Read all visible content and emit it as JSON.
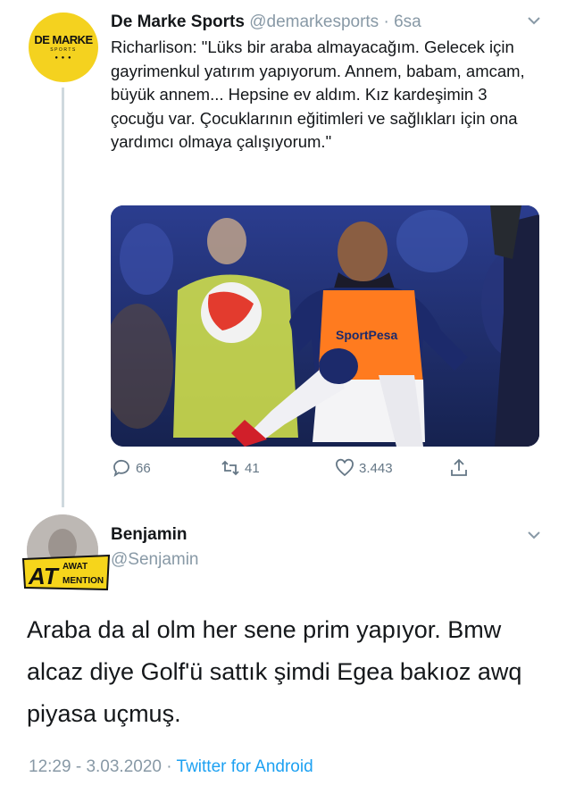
{
  "parent_tweet": {
    "author_name": "De Marke Sports",
    "author_handle": "@demarkesports",
    "separator": " · ",
    "time_ago": "6sa",
    "avatar_logo": "DE MARKE",
    "avatar_sub": "SPORTS",
    "text": "Richarlison: \"Lüks bir araba almayacağım. Gelecek için gayrimenkul yatırım yapıyorum. Annem, babam, amcam, büyük annem... Hepsine ev aldım. Kız kardeşimin 3 çocuğu var. Çocuklarının eğitimleri ve sağlıkları için ona yardımcı olmaya çalışıyorum.\"",
    "photo_shirt_text": "SportPesa",
    "actions": {
      "replies": "66",
      "retweets": "41",
      "likes": "3.443"
    },
    "icons": [
      "reply-icon",
      "retweet-icon",
      "like-icon",
      "share-icon",
      "chevron-down-icon"
    ]
  },
  "reply_tweet": {
    "author_name": "Benjamin",
    "author_handle": "@Senjamin",
    "badge_text_top": "AWAT",
    "badge_text_main": "AT",
    "badge_text_right": "MENTION",
    "text": "Araba da al olm her sene prim yapıyor. Bmw alcaz diye Golf'ü sattık şimdi Egea bakıoz awq piyasa uçmuş.",
    "time": "12:29",
    "separator": " - ",
    "date": "3.03.2020",
    "separator2": " · ",
    "source": "Twitter for Android"
  },
  "colors": {
    "accent": "#1da1f2",
    "muted": "#8899a6",
    "avatar_yellow": "#f4d21f",
    "thread_line": "#cfd9de",
    "jersey_orange": "#ff7b1f"
  }
}
